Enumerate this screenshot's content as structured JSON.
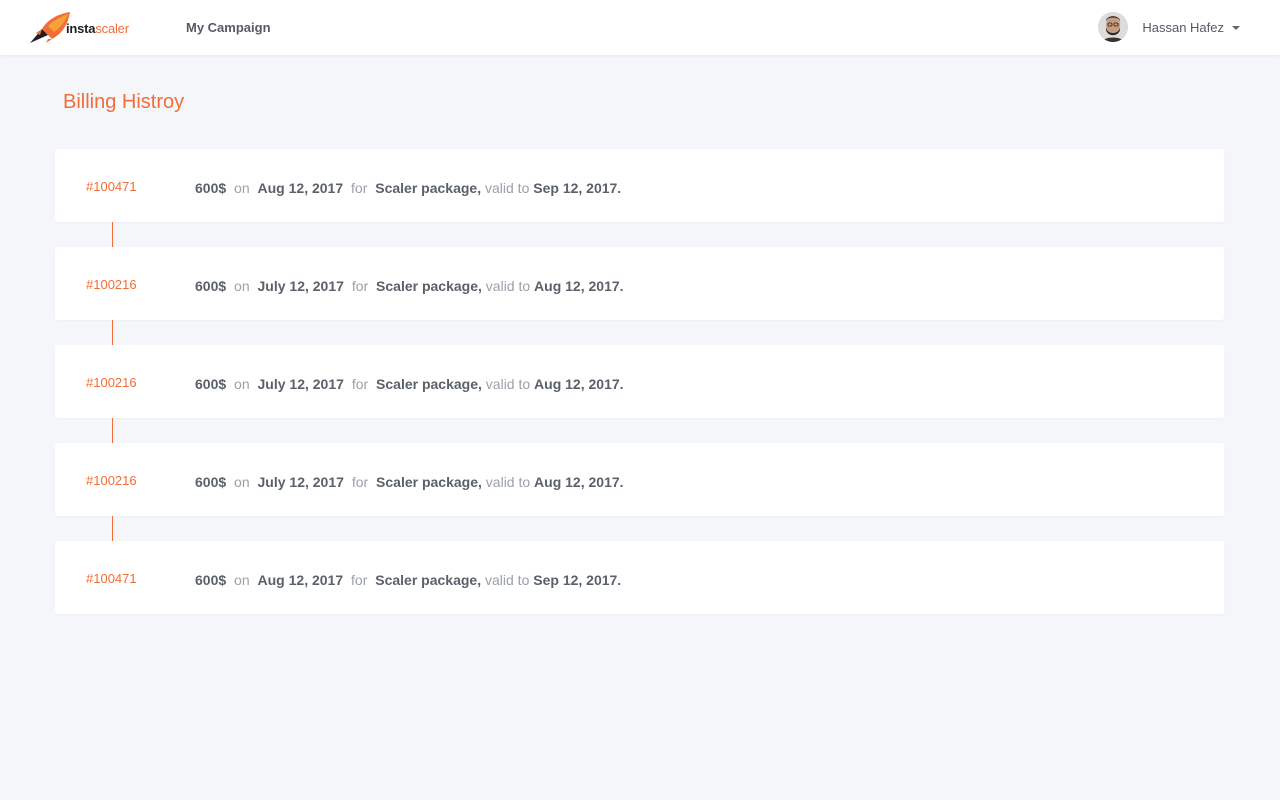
{
  "brand": {
    "logo_text_primary": "insta",
    "logo_text_secondary": "scaler",
    "accent_color": "#f26d37"
  },
  "nav": {
    "campaign_label": "My Campaign"
  },
  "user": {
    "name": "Hassan Hafez",
    "avatar_icon": "user-avatar"
  },
  "page": {
    "title": "Billing Histroy"
  },
  "billing": {
    "on_word": "on",
    "for_word": "for",
    "valid_word": "valid to",
    "items": [
      {
        "id": "#100471",
        "amount": "600$",
        "date": "Aug 12, 2017",
        "package": "Scaler package,",
        "valid_until": "Sep 12, 2017."
      },
      {
        "id": "#100216",
        "amount": "600$",
        "date": "July 12, 2017",
        "package": "Scaler package,",
        "valid_until": "Aug 12, 2017."
      },
      {
        "id": "#100216",
        "amount": "600$",
        "date": "July 12, 2017",
        "package": "Scaler package,",
        "valid_until": "Aug 12, 2017."
      },
      {
        "id": "#100216",
        "amount": "600$",
        "date": "July 12, 2017",
        "package": "Scaler package,",
        "valid_until": "Aug 12, 2017."
      },
      {
        "id": "#100471",
        "amount": "600$",
        "date": "Aug 12, 2017",
        "package": "Scaler package,",
        "valid_until": "Sep 12, 2017."
      }
    ]
  }
}
